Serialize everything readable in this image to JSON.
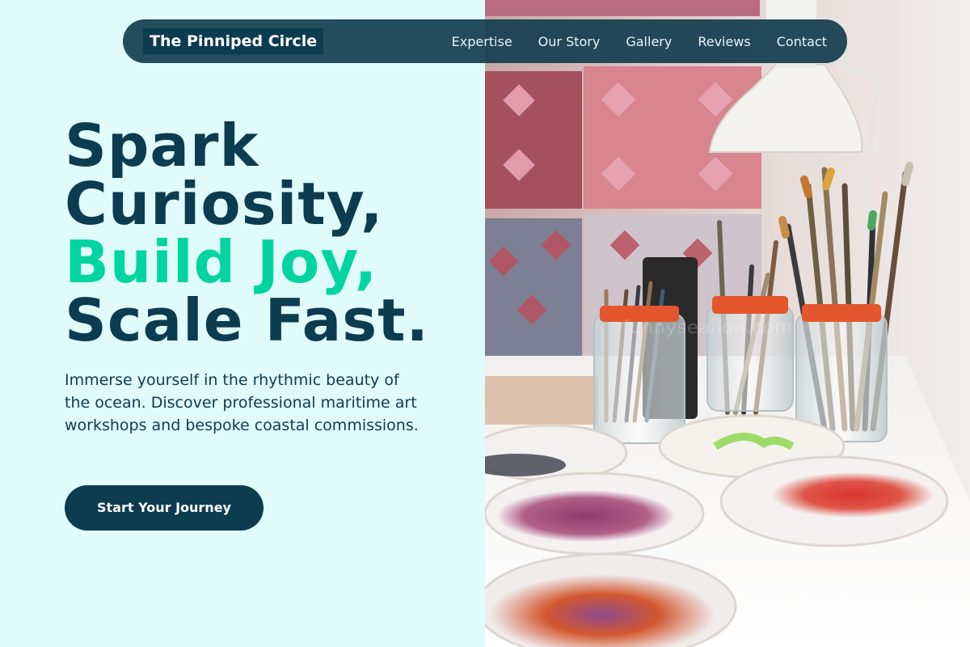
{
  "brand": {
    "name": "The Pinniped Circle"
  },
  "nav": {
    "items": [
      {
        "label": "Expertise"
      },
      {
        "label": "Our Story"
      },
      {
        "label": "Gallery"
      },
      {
        "label": "Reviews"
      },
      {
        "label": "Contact"
      }
    ]
  },
  "hero": {
    "headline_line1": "Spark",
    "headline_line2": "Curiosity,",
    "headline_line3": "Build Joy,",
    "headline_line4": "Scale Fast.",
    "subtext": "Immerse yourself in the rhythmic beauty of the ocean. Discover professional maritime art workshops and bespoke coastal commissions.",
    "cta_label": "Start Your Journey"
  },
  "photo": {
    "watermark": "funnysealion.com",
    "subject": "art studio table with paintbrush jars and paint palettes"
  },
  "colors": {
    "background": "#e0fbfc",
    "primary": "#0d3b50",
    "accent": "#00d4a0"
  }
}
